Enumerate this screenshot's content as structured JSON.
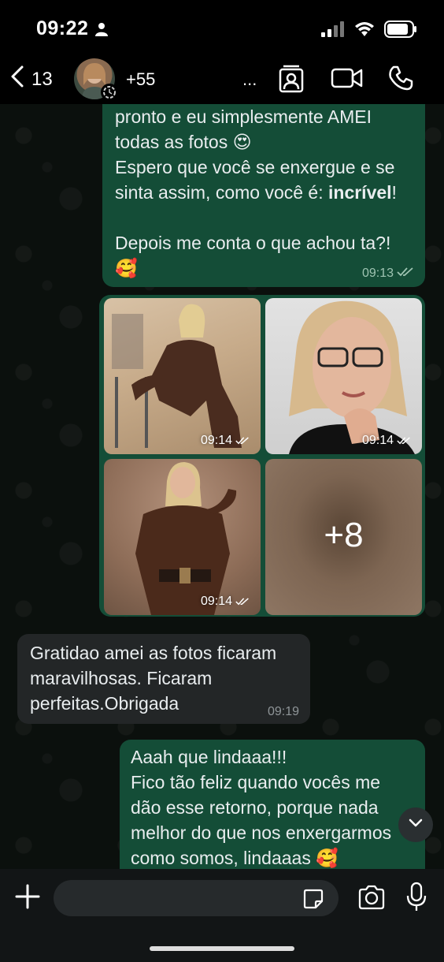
{
  "status_bar": {
    "time": "09:22",
    "battery_level": 0.85
  },
  "header": {
    "back_count": "13",
    "contact_number": "+55",
    "ellipsis": "..."
  },
  "messages": {
    "m1": {
      "lines": "pronto e eu simplesmente AMEI\ntodas as fotos 😍\nEspero que você se enxergue e se\nsinta assim, como você é: ",
      "bold": "incrível",
      "tail": "!\n\nDepois me conta o que achou ta?!\n🥰",
      "time": "09:13"
    },
    "photos": [
      {
        "time": "09:14"
      },
      {
        "time": "09:14"
      },
      {
        "time": "09:14"
      },
      {
        "more": "+8"
      }
    ],
    "m2": {
      "text": "Gratidao amei as fotos ficaram\nmaravilhosas. Ficaram\nperfeitas.Obrigada",
      "time": "09:19"
    },
    "m3": {
      "text": "Aaah que lindaaa!!!\nFico tão feliz quando vocês me\ndão esse retorno, porque nada\nmelhor do que nos enxergarmos\ncomo somos, lindaaas 🥰"
    }
  },
  "input": {
    "placeholder": ""
  },
  "colors": {
    "outgoing_bubble": "#144d37",
    "incoming_bubble": "#232627",
    "background": "#0b100d"
  }
}
